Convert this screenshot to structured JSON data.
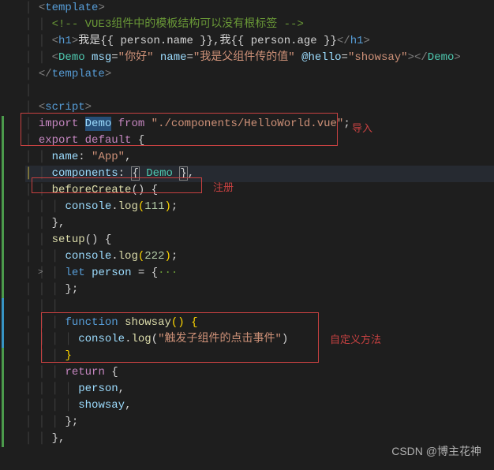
{
  "annotations": {
    "import": "导入",
    "register": "注册",
    "custom": "自定义方法"
  },
  "watermark": "CSDN @博主花神",
  "code": {
    "template_open": "template",
    "template_close": "template",
    "comment_line": "<!-- VUE3组件中的模板结构可以没有根标签 -->",
    "h1_tag": "h1",
    "h1_text_1": "我是",
    "h1_bind_1": "{{ person.name }}",
    "h1_text_2": ",我",
    "h1_bind_2": "{{ person.age }}",
    "demo_tag": "Demo",
    "demo_attr_msg": "msg",
    "demo_val_msg": "\"你好\"",
    "demo_attr_name": "name",
    "demo_val_name": "\"我是父组件传的值\"",
    "demo_attr_hello": "@hello",
    "demo_val_hello": "\"showsay\"",
    "script_tag": "script",
    "import_kw": "import",
    "import_name": "Demo",
    "from_kw": "from",
    "import_path": "\"./components/HelloWorld.vue\"",
    "export_kw": "export",
    "default_kw": "default",
    "name_prop": "name",
    "name_val": "\"App\"",
    "components_prop": "components",
    "components_val": "Demo",
    "before_create": "beforeCreate",
    "console": "console",
    "log": "log",
    "log_111": "111",
    "setup": "setup",
    "log_222": "222",
    "let_kw": "let",
    "person_var": "person",
    "ellipsis": "···",
    "function_kw": "function",
    "showsay_fn": "showsay",
    "log_str": "\"触发子组件的点击事件\"",
    "return_kw": "return",
    "return_person": "person",
    "return_showsay": "showsay"
  }
}
